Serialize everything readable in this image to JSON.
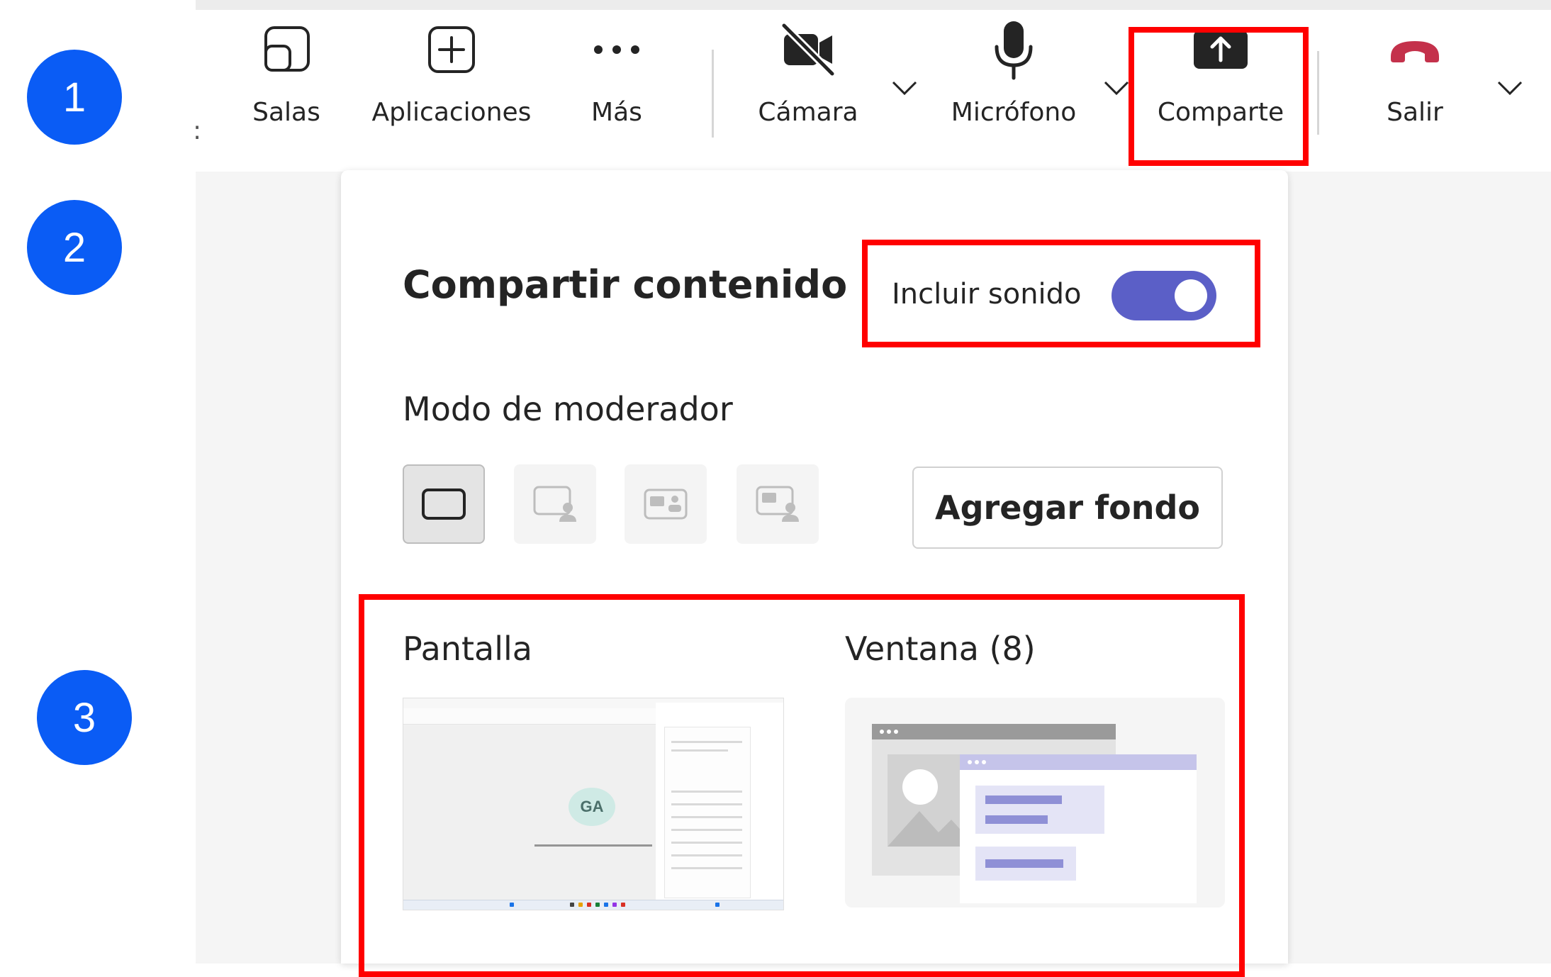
{
  "steps": [
    "1",
    "2",
    "3"
  ],
  "toolbar": {
    "truncated_label": ":",
    "rooms": "Salas",
    "apps": "Aplicaciones",
    "more": "Más",
    "camera": "Cámara",
    "mic": "Micrófono",
    "share": "Comparte",
    "leave": "Salir"
  },
  "share_panel": {
    "title": "Compartir contenido",
    "include_sound": {
      "label": "Incluir sonido",
      "on": true
    },
    "presenter_mode": {
      "title": "Modo de moderador",
      "options": [
        "content-only",
        "standout",
        "side-by-side",
        "reporter"
      ],
      "selected": "content-only"
    },
    "add_background": "Agregar fondo",
    "screen": {
      "title": "Pantalla",
      "avatar_initials": "GA"
    },
    "window": {
      "title": "Ventana (8)"
    }
  },
  "colors": {
    "badge": "#0a5cf5",
    "highlight": "#ff0000",
    "toggle_on": "#5b5fc7",
    "leave": "#c4314b"
  }
}
